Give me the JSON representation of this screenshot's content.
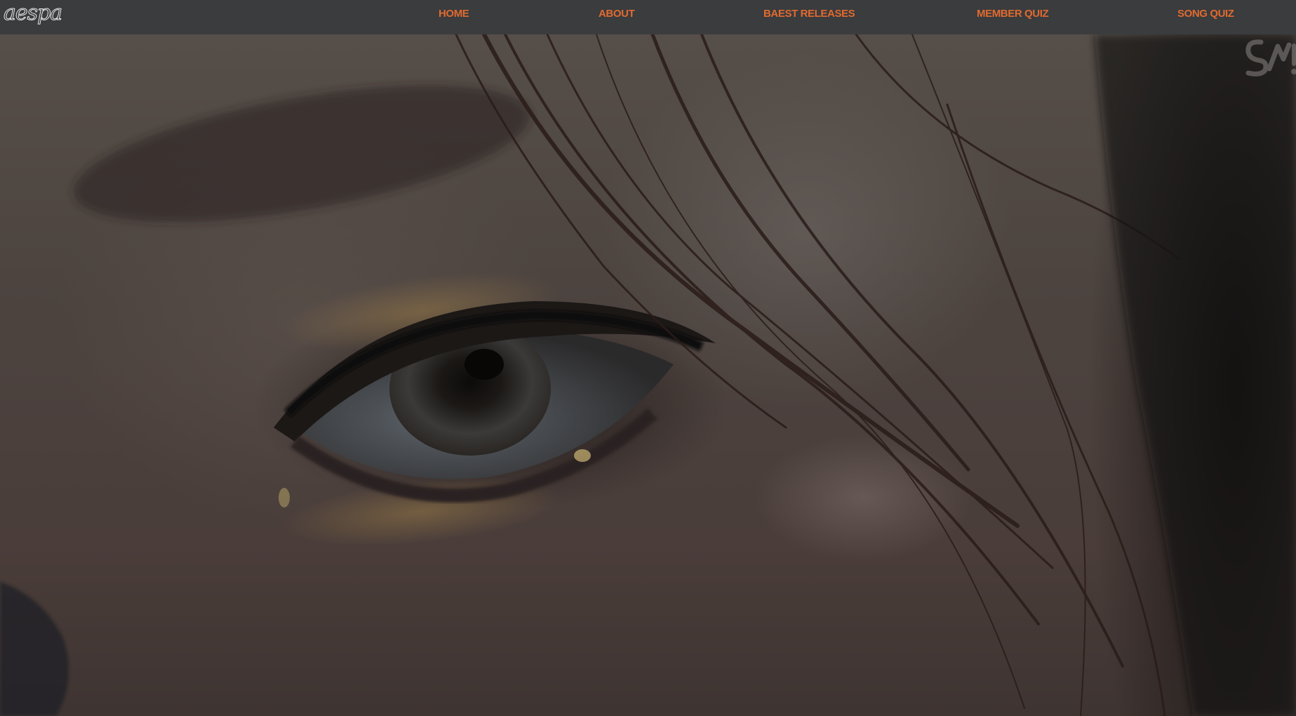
{
  "header": {
    "logo_text": "aespa",
    "nav": [
      {
        "label": "HOME"
      },
      {
        "label": "ABOUT"
      },
      {
        "label": "BAEST RELEASES"
      },
      {
        "label": "MEMBER QUIZ"
      },
      {
        "label": "SONG QUIZ"
      }
    ]
  },
  "hero": {
    "image_icon": "eye-closeup-photo",
    "watermark_icon": "sm-logo-icon"
  },
  "colors": {
    "nav_background": "#3a3c3e",
    "nav_link": "#e06a2f",
    "logo": "#e6e6e6"
  }
}
